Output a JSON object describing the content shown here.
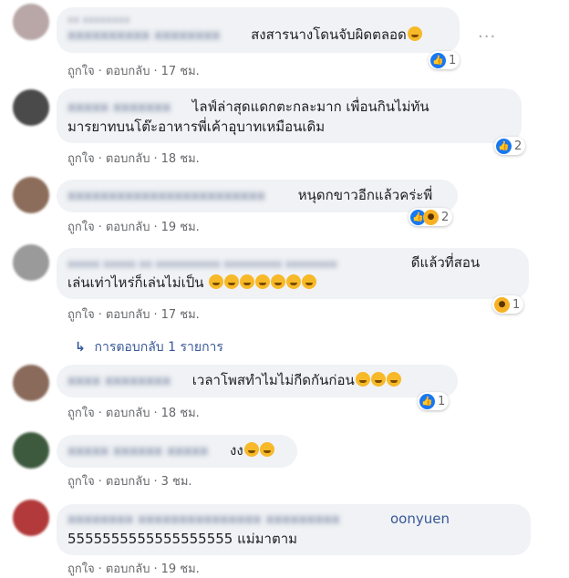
{
  "meta_labels": {
    "like": "ถูกใจ",
    "reply": "ตอบกลับ",
    "separator": "·"
  },
  "more_options": "···",
  "comments": [
    {
      "text": "สงสารนางโดนจับผิดตลอด",
      "time": "17 ชม.",
      "reaction_count": "1",
      "reactions": [
        "like-icon"
      ]
    },
    {
      "text_line1": "ไลฟ์ล่าสุดแดกตะกละมาก เพื่อนกินไม่ทัน",
      "text_line2": "มารยาทบนโต๊ะอาหารพี่เค้าอุบาทเหมือนเดิม",
      "time": "18 ชม.",
      "reaction_count": "2",
      "reactions": [
        "like-icon"
      ]
    },
    {
      "text": "หนุดกขาวอีกแล้วคร่ะพี่",
      "time": "19 ชม.",
      "reaction_count": "2",
      "reactions": [
        "like-icon",
        "haha-icon"
      ]
    },
    {
      "text_line1": "ดีแล้วที่สอน",
      "text_line2": "เล่นเท่าไหร่ก็เล่นไม่เป็น",
      "time": "17 ชม.",
      "reaction_count": "1",
      "reactions": [
        "haha-icon"
      ]
    },
    {
      "text": "เวลาโพสทำไมไม่กีดกันก่อน",
      "time": "18 ชม.",
      "reaction_count": "1",
      "reactions": [
        "like-icon"
      ]
    },
    {
      "text": "งง",
      "time": "3 ชม."
    },
    {
      "name_tail": "oonyuen",
      "text": "5555555555555555555 แม่มาตาม",
      "time": "19 ชม."
    }
  ],
  "replies_link": "การตอบกลับ 1 รายการ",
  "reply_arrow": "↳",
  "colors": {
    "bubble": "#f0f2f5",
    "link": "#385898",
    "like": "#1877f2",
    "haha": "#f7b125",
    "meta": "#65676b"
  }
}
